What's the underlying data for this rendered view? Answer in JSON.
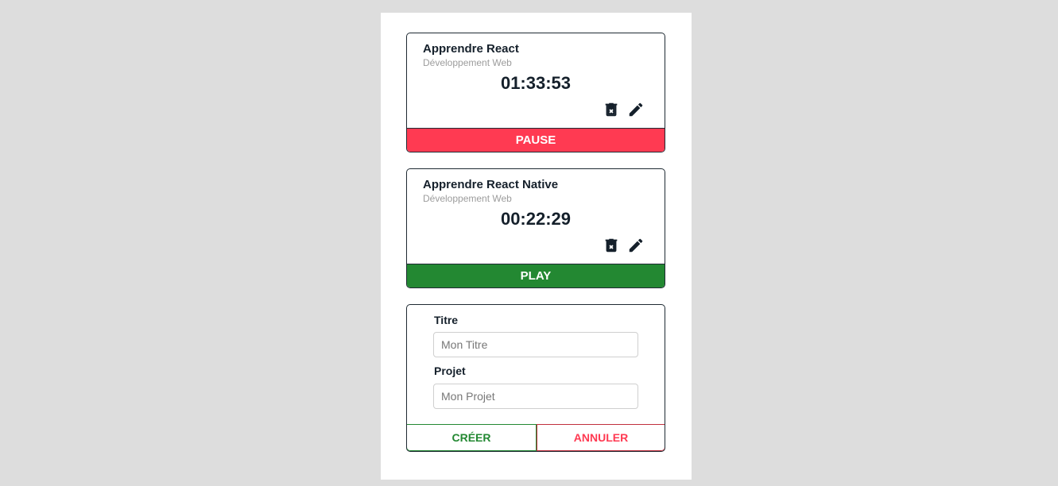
{
  "colors": {
    "background": "#dddddd",
    "panel": "#ffffff",
    "pause": "#ff3a52",
    "play": "#238832",
    "text": "#15202b",
    "muted": "#9c9c9c"
  },
  "timers": [
    {
      "title": "Apprendre React",
      "project": "Développement Web",
      "elapsed": "01:33:53",
      "action_label": "PAUSE",
      "running": true,
      "icons": [
        "trash-icon",
        "pencil-icon"
      ]
    },
    {
      "title": "Apprendre React Native",
      "project": "Développement Web",
      "elapsed": "00:22:29",
      "action_label": "PLAY",
      "running": false,
      "icons": [
        "trash-icon",
        "pencil-icon"
      ]
    }
  ],
  "form": {
    "title_label": "Titre",
    "title_placeholder": "Mon Titre",
    "title_value": "",
    "project_label": "Projet",
    "project_placeholder": "Mon Projet",
    "project_value": "",
    "create_label": "CRÉER",
    "cancel_label": "ANNULER"
  }
}
